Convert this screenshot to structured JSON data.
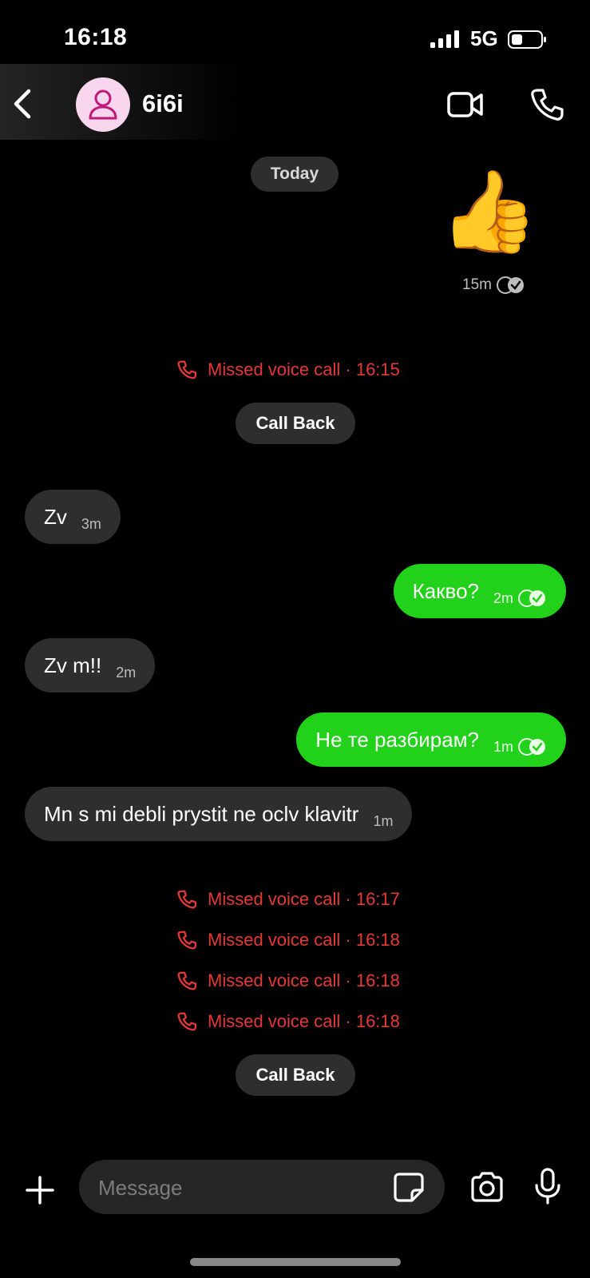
{
  "status_bar": {
    "time": "16:18",
    "network": "5G"
  },
  "header": {
    "contact_name": "6i6i"
  },
  "date_chip": "Today",
  "thumbs_message": {
    "emoji": "👍",
    "time": "15m"
  },
  "missed_call_1": {
    "text": "Missed voice call · 16:15"
  },
  "call_back_1": "Call Back",
  "messages": [
    {
      "direction": "incoming",
      "text": "Zv",
      "time": "3m"
    },
    {
      "direction": "outgoing",
      "text": "Какво?",
      "time": "2m"
    },
    {
      "direction": "incoming",
      "text": "Zv m!!",
      "time": "2m"
    },
    {
      "direction": "outgoing",
      "text": "Не те разбирам?",
      "time": "1m"
    },
    {
      "direction": "incoming",
      "text": "Mn s mi debli prystit ne oclv klavitr",
      "time": "1m"
    }
  ],
  "missed_calls_2": [
    {
      "text": "Missed voice call · 16:17"
    },
    {
      "text": "Missed voice call · 16:18"
    },
    {
      "text": "Missed voice call · 16:18"
    },
    {
      "text": "Missed voice call · 16:18"
    }
  ],
  "call_back_2": "Call Back",
  "composer": {
    "placeholder": "Message"
  },
  "colors": {
    "outgoing_bubble": "#22d119",
    "incoming_bubble": "#2e2e2e",
    "missed_call": "#e53935",
    "avatar_bg": "#f7d6ee"
  },
  "icons": [
    "back-icon",
    "person-icon",
    "video-call-icon",
    "voice-call-icon",
    "read-receipt-icon",
    "missed-call-icon",
    "plus-icon",
    "sticker-icon",
    "camera-icon",
    "microphone-icon"
  ]
}
